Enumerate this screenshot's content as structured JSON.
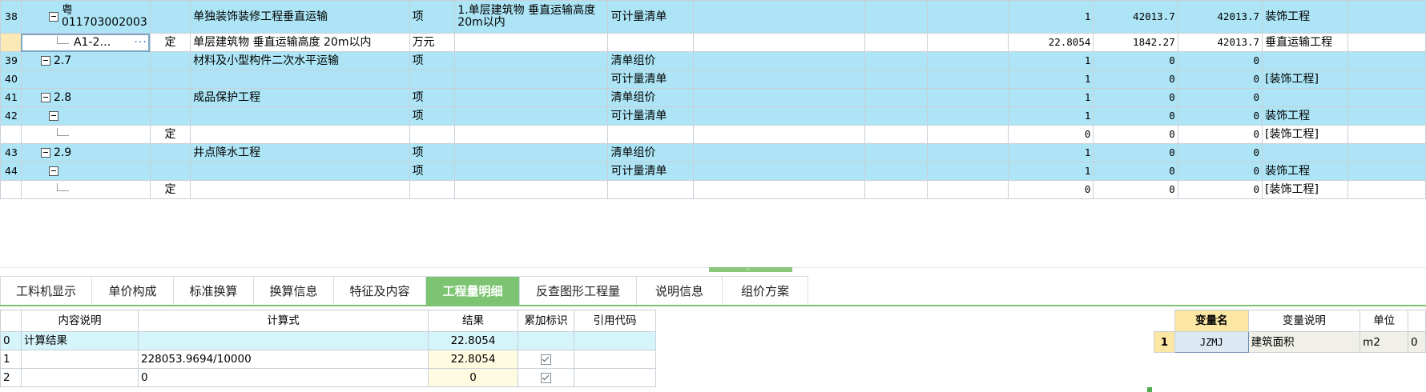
{
  "grid": {
    "rows": [
      {
        "idx": "38",
        "tall": true,
        "style": "blue",
        "toggle": true,
        "code_top": "粤",
        "code_bottom": "011703002003",
        "type": "",
        "name": "单独装饰装修工程垂直运输",
        "unit": "项",
        "feature": "1.单层建筑物 垂直运输高度20m以内",
        "kind": "可计量清单",
        "extra": "",
        "qty": "1",
        "price": "42013.7",
        "total": "42013.7",
        "prof": "装饰工程"
      },
      {
        "idx": "",
        "selected": true,
        "style": "white",
        "child": true,
        "code": "A1-2…",
        "type": "定",
        "name": "单层建筑物 垂直运输高度 20m以内",
        "unit": "万元",
        "feature": "",
        "kind": "",
        "extra": "",
        "qty": "22.8054",
        "price": "1842.27",
        "total": "42013.7",
        "prof": "垂直运输工程"
      },
      {
        "idx": "39",
        "style": "blue",
        "toggle": true,
        "code": "2.7",
        "type": "",
        "name": "材料及小型构件二次水平运输",
        "unit": "项",
        "feature": "",
        "kind": "清单组价",
        "extra": "",
        "qty": "1",
        "price": "0",
        "total": "0",
        "prof": ""
      },
      {
        "idx": "40",
        "style": "blue",
        "code": "",
        "type": "",
        "name": "",
        "unit": "",
        "feature": "",
        "kind": "可计量清单",
        "extra": "",
        "qty": "1",
        "price": "0",
        "total": "0",
        "prof": "[装饰工程]"
      },
      {
        "idx": "41",
        "style": "blue",
        "toggle": true,
        "code": "2.8",
        "type": "",
        "name": "成品保护工程",
        "unit": "项",
        "feature": "",
        "kind": "清单组价",
        "extra": "",
        "qty": "1",
        "price": "0",
        "total": "0",
        "prof": ""
      },
      {
        "idx": "42",
        "style": "blue",
        "toggle": true,
        "toggle_offset": true,
        "code": "",
        "type": "",
        "name": "",
        "unit": "项",
        "feature": "",
        "kind": "可计量清单",
        "extra": "",
        "qty": "1",
        "price": "0",
        "total": "0",
        "prof": "装饰工程"
      },
      {
        "idx": "",
        "style": "white",
        "child": true,
        "code": "",
        "type": "定",
        "name": "",
        "unit": "",
        "feature": "",
        "kind": "",
        "extra": "",
        "qty": "0",
        "price": "0",
        "total": "0",
        "prof": "[装饰工程]"
      },
      {
        "idx": "43",
        "style": "blue",
        "toggle": true,
        "code": "2.9",
        "type": "",
        "name": "井点降水工程",
        "unit": "项",
        "feature": "",
        "kind": "清单组价",
        "extra": "",
        "qty": "1",
        "price": "0",
        "total": "0",
        "prof": ""
      },
      {
        "idx": "44",
        "style": "blue",
        "toggle": true,
        "toggle_offset": true,
        "code": "",
        "type": "",
        "name": "",
        "unit": "项",
        "feature": "",
        "kind": "可计量清单",
        "extra": "",
        "qty": "1",
        "price": "0",
        "total": "0",
        "prof": "装饰工程"
      },
      {
        "idx": "",
        "style": "white",
        "child": true,
        "code": "",
        "type": "定",
        "name": "",
        "unit": "",
        "feature": "",
        "kind": "",
        "extra": "",
        "qty": "0",
        "price": "0",
        "total": "0",
        "prof": "[装饰工程]"
      }
    ]
  },
  "tabs": [
    {
      "label": "工料机显示",
      "active": false
    },
    {
      "label": "单价构成",
      "active": false
    },
    {
      "label": "标准换算",
      "active": false
    },
    {
      "label": "换算信息",
      "active": false
    },
    {
      "label": "特征及内容",
      "active": false
    },
    {
      "label": "工程量明细",
      "active": true
    },
    {
      "label": "反查图形工程量",
      "active": false
    },
    {
      "label": "说明信息",
      "active": false
    },
    {
      "label": "组价方案",
      "active": false
    }
  ],
  "calc": {
    "headers": {
      "desc": "内容说明",
      "formula": "计算式",
      "result": "结果",
      "accum": "累加标识",
      "ref": "引用代码"
    },
    "rows": [
      {
        "idx": "0",
        "desc": "计算结果",
        "formula": "",
        "result": "22.8054",
        "checked": false,
        "sum": true
      },
      {
        "idx": "1",
        "desc": "",
        "formula": "228053.9694/10000",
        "result": "22.8054",
        "checked": true,
        "sum": false
      },
      {
        "idx": "2",
        "desc": "",
        "formula": "0",
        "result": "0",
        "checked": true,
        "sum": false
      }
    ]
  },
  "vars": {
    "headers": {
      "name": "变量名",
      "desc": "变量说明",
      "unit": "单位"
    },
    "rows": [
      {
        "rn": "1",
        "name": "JZMJ",
        "desc": "建筑面积",
        "unit": "m2",
        "val": "0"
      }
    ]
  }
}
